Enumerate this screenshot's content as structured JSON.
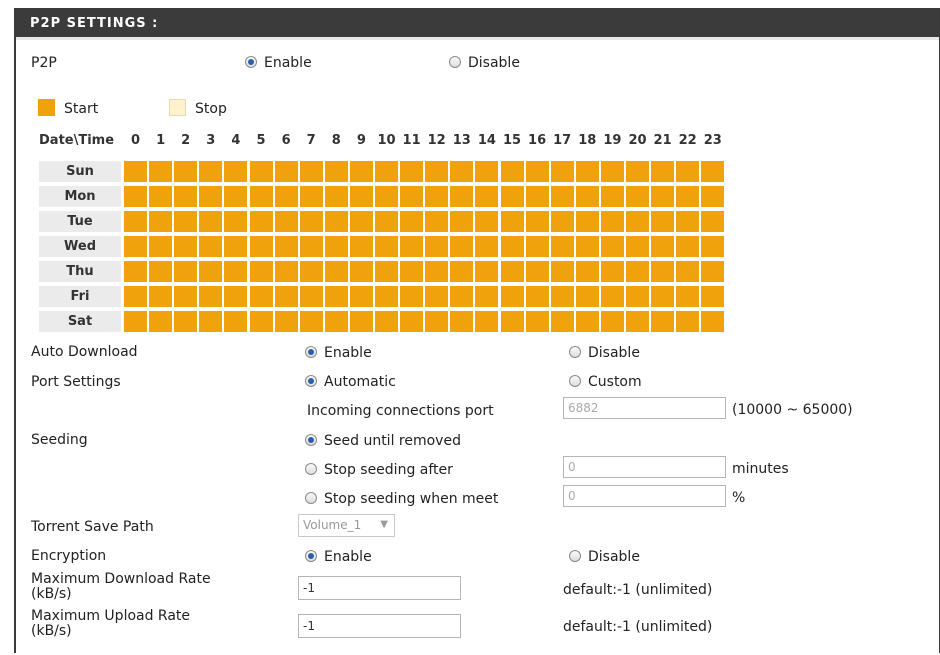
{
  "section_title": "P2P SETTINGS :",
  "p2p": {
    "label": "P2P",
    "enable": "Enable",
    "disable": "Disable",
    "selected": "enable"
  },
  "legend": {
    "start": "Start",
    "stop": "Stop",
    "start_color": "#f0a20c",
    "stop_color": "#fff2cc"
  },
  "schedule": {
    "corner": "Date\\Time",
    "hours": [
      "0",
      "1",
      "2",
      "3",
      "4",
      "5",
      "6",
      "7",
      "8",
      "9",
      "10",
      "11",
      "12",
      "13",
      "14",
      "15",
      "16",
      "17",
      "18",
      "19",
      "20",
      "21",
      "22",
      "23"
    ],
    "days": [
      "Sun",
      "Mon",
      "Tue",
      "Wed",
      "Thu",
      "Fri",
      "Sat"
    ],
    "all_state": "start"
  },
  "auto_download": {
    "label": "Auto Download",
    "enable": "Enable",
    "disable": "Disable",
    "selected": "enable"
  },
  "port_settings": {
    "label": "Port Settings",
    "automatic": "Automatic",
    "custom": "Custom",
    "selected": "automatic",
    "incoming_label": "Incoming connections port",
    "incoming_value": "6882",
    "range_hint": "(10000 ~ 65000)"
  },
  "seeding": {
    "label": "Seeding",
    "until_removed": "Seed until removed",
    "stop_after": "Stop seeding after",
    "stop_when_meet": "Stop seeding when meet",
    "stop_after_value": "0",
    "stop_after_unit": "minutes",
    "meet_value": "0",
    "meet_unit": "%",
    "selected": "until_removed"
  },
  "torrent_save_path": {
    "label": "Torrent Save Path",
    "value": "Volume_1"
  },
  "encryption": {
    "label": "Encryption",
    "enable": "Enable",
    "disable": "Disable",
    "selected": "enable"
  },
  "max_download": {
    "label_line1": "Maximum Download Rate",
    "label_line2": "(kB/s)",
    "value": "-1",
    "default": "default:-1 (unlimited)"
  },
  "max_upload": {
    "label_line1": "Maximum Upload Rate",
    "label_line2": "(kB/s)",
    "value": "-1",
    "default": "default:-1 (unlimited)"
  }
}
